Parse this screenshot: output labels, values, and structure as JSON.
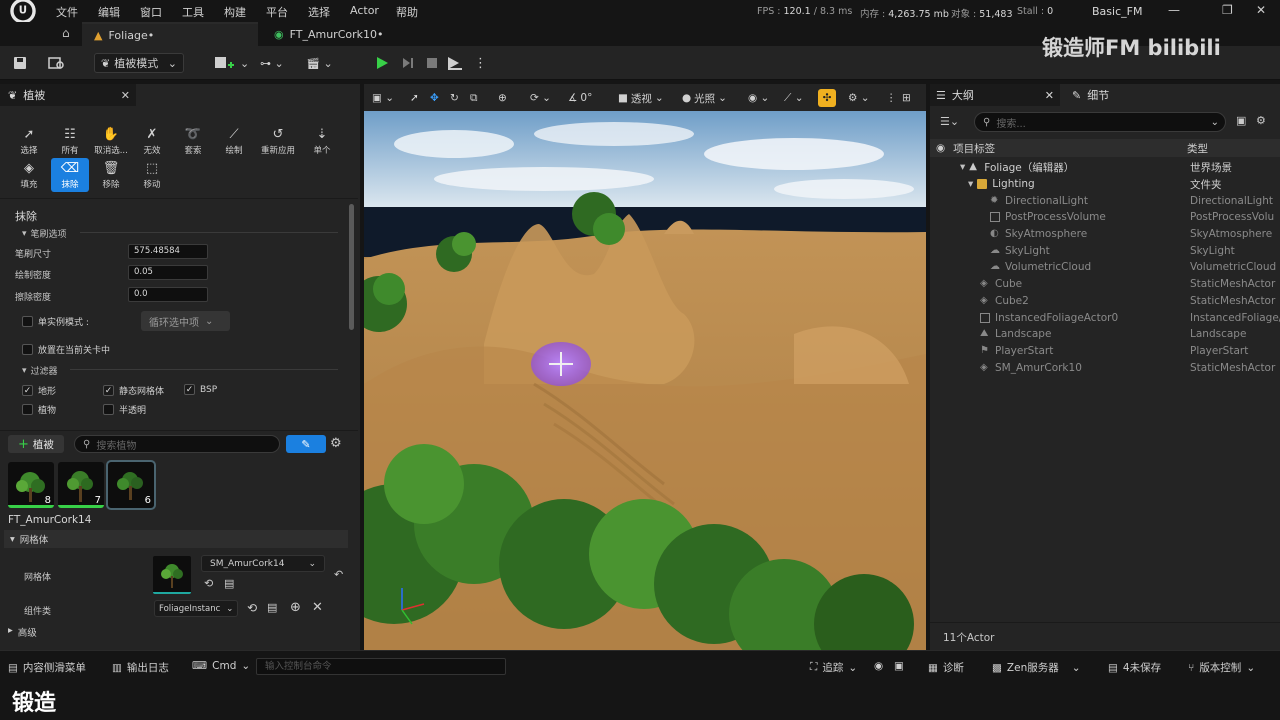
{
  "menu": [
    "文件",
    "编辑",
    "窗口",
    "工具",
    "构建",
    "平台",
    "选择",
    "Actor",
    "帮助"
  ],
  "stats": {
    "fps_label": "FPS :",
    "fps_value": "120.1",
    "ms_value": "/ 8.3 ms",
    "mem_label": "内存 :",
    "mem_value": "4,263.75 mb",
    "obj_label": "对象 :",
    "obj_value": "51,483",
    "stall_label": "Stall :",
    "stall_value": "0",
    "project": "Basic_FM"
  },
  "tabs": {
    "foliage": "Foliage•",
    "amur": "FT_AmurCork10•"
  },
  "toolbar": {
    "mode": "植被模式"
  },
  "left_panel": {
    "tab_title": "植被",
    "tools_row1": [
      "选择",
      "所有",
      "取消选...",
      "无效",
      "套索",
      "绘制",
      "重新应用",
      "单个"
    ],
    "tools_row2": [
      "填充",
      "抹除",
      "移除",
      "移动"
    ],
    "active_tool": "抹除",
    "section_title": "抹除",
    "brush_section": "笔刷选项",
    "brush_size_label": "笔刷尺寸",
    "brush_size": "575.48584",
    "paint_density_label": "绘制密度",
    "paint_density": "0.05",
    "erase_density_label": "擦除密度",
    "erase_density": "0.0",
    "single_instance_label": "单实例模式 :",
    "single_instance_value": "循环选中项",
    "place_current_level": "放置在当前关卡中",
    "filter_section": "过滤器",
    "filters": [
      {
        "label": "地形",
        "checked": true
      },
      {
        "label": "静态网格体",
        "checked": true
      },
      {
        "label": "BSP",
        "checked": true
      },
      {
        "label": "植物",
        "checked": false
      },
      {
        "label": "半透明",
        "checked": false
      }
    ],
    "add_foliage": "植被",
    "search_placeholder": "搜索植物",
    "thumbs": [
      "8",
      "7",
      "6"
    ],
    "selected_asset": "FT_AmurCork14",
    "mesh_section": "网格体",
    "mesh_label": "网格体",
    "mesh_value": "SM_AmurCork14",
    "component_label": "组件类",
    "component_value": "FoliageInstanc",
    "advanced": "高级"
  },
  "viewport": {
    "perspective": "透视",
    "lighting": "光照",
    "snap_value": "0°"
  },
  "outliner": {
    "tab_outliner": "大纲",
    "tab_details": "细节",
    "search_placeholder": "搜索...",
    "col_label": "项目标签",
    "col_type": "类型",
    "rows": [
      {
        "name": "Foliage（编辑器）",
        "type": "世界场景",
        "indent": 0
      },
      {
        "name": "Lighting",
        "type": "文件夹",
        "indent": 1
      },
      {
        "name": "DirectionalLight",
        "type": "DirectionalLight",
        "indent": 2
      },
      {
        "name": "PostProcessVolume",
        "type": "PostProcessVolu",
        "indent": 2
      },
      {
        "name": "SkyAtmosphere",
        "type": "SkyAtmosphere",
        "indent": 2
      },
      {
        "name": "SkyLight",
        "type": "SkyLight",
        "indent": 2
      },
      {
        "name": "VolumetricCloud",
        "type": "VolumetricCloud",
        "indent": 2
      },
      {
        "name": "Cube",
        "type": "StaticMeshActor",
        "indent": 1
      },
      {
        "name": "Cube2",
        "type": "StaticMeshActor",
        "indent": 1
      },
      {
        "name": "InstancedFoliageActor0",
        "type": "InstancedFoliage/",
        "indent": 1
      },
      {
        "name": "Landscape",
        "type": "Landscape",
        "indent": 1
      },
      {
        "name": "PlayerStart",
        "type": "PlayerStart",
        "indent": 1
      },
      {
        "name": "SM_AmurCork10",
        "type": "StaticMeshActor",
        "indent": 1
      }
    ],
    "count": "11个Actor"
  },
  "statusbar": {
    "content_drawer": "内容侧滑菜单",
    "output_log": "输出日志",
    "cmd": "Cmd",
    "cmd_placeholder": "输入控制台命令",
    "trace": "追踪",
    "diagnostics": "诊断",
    "zen": "Zen服务器",
    "unsaved": "4未保存",
    "source_control": "版本控制"
  },
  "caption": "锻造",
  "watermark": "锻造师FM bilibili",
  "colors": {
    "accent": "#1b80e0",
    "play_green": "#38d048",
    "sand": "#b3854a"
  }
}
